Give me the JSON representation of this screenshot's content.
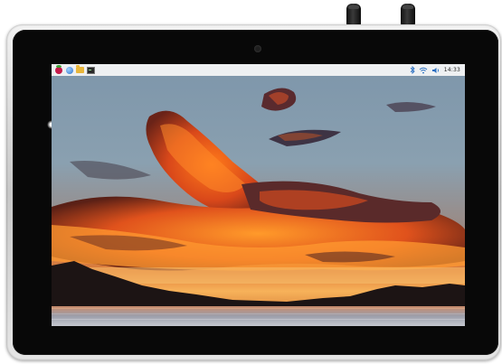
{
  "taskbar": {
    "left_icons": [
      "raspberry-menu-icon",
      "web-browser-icon",
      "file-manager-icon",
      "terminal-icon"
    ],
    "tray_icons": [
      "bluetooth-icon",
      "wifi-icon",
      "volume-icon"
    ],
    "clock": "14:33"
  },
  "wallpaper": {
    "subject": "sunset-clouds-over-mountains-and-lake"
  },
  "colors": {
    "taskbar_bg": "#eef0f2",
    "bezel": "#080808",
    "frame": "#d6d6d6",
    "raspberry": "#c51a4a",
    "tray_blue": "#2a6fc1"
  }
}
